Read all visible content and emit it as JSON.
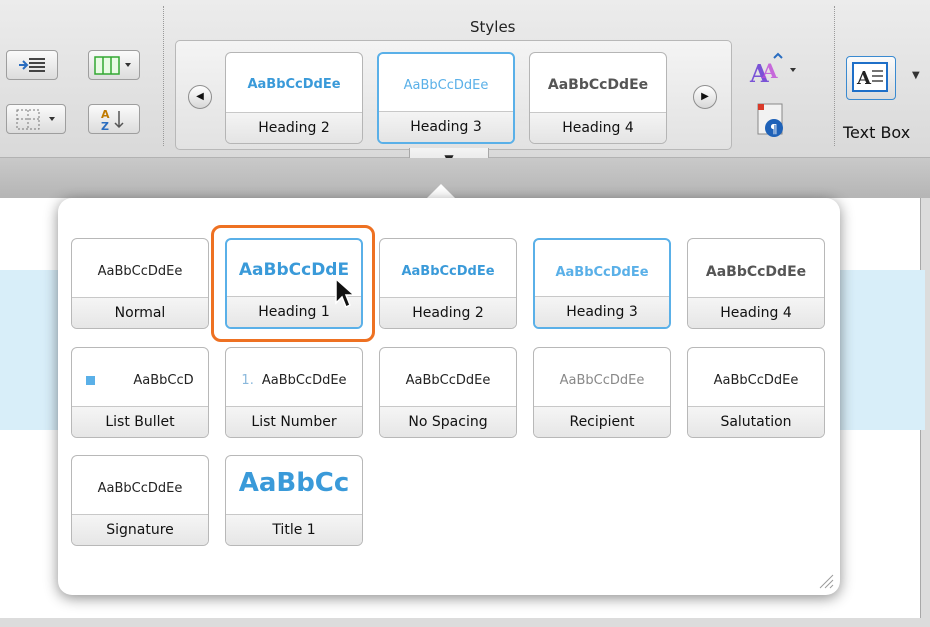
{
  "ribbon": {
    "group_title": "Styles",
    "text_box_label": "Text Box",
    "gallery": [
      {
        "label": "Heading 2",
        "sample": "AaBbCcDdEe",
        "color": "#3a9ad9",
        "bold": true,
        "selected": false
      },
      {
        "label": "Heading 3",
        "sample": "AaBbCcDdEe",
        "color": "#5ab0e8",
        "bold": false,
        "selected": true
      },
      {
        "label": "Heading 4",
        "sample": "AaBbCcDdEe",
        "color": "#555555",
        "bold": true,
        "selected": false
      }
    ]
  },
  "popup": {
    "styles": [
      {
        "label": "Normal",
        "sample": "AaBbCcDdEe",
        "color": "#222222"
      },
      {
        "label": "Heading 1",
        "sample": "AaBbCcDdE",
        "color": "#3a9ad9",
        "selected": true
      },
      {
        "label": "Heading 2",
        "sample": "AaBbCcDdEe",
        "color": "#3a9ad9"
      },
      {
        "label": "Heading 3",
        "sample": "AaBbCcDdEe",
        "color": "#5ab0e8",
        "selected": true
      },
      {
        "label": "Heading 4",
        "sample": "AaBbCcDdEe",
        "color": "#555555"
      },
      {
        "label": "List Bullet",
        "sample": "AaBbCcD",
        "color": "#222222"
      },
      {
        "label": "List Number",
        "sample": "AaBbCcDdEe",
        "prefix": "1.",
        "color": "#222222"
      },
      {
        "label": "No Spacing",
        "sample": "AaBbCcDdEe",
        "color": "#222222"
      },
      {
        "label": "Recipient",
        "sample": "AaBbCcDdEe",
        "color": "#888888"
      },
      {
        "label": "Salutation",
        "sample": "AaBbCcDdEe",
        "color": "#222222"
      },
      {
        "label": "Signature",
        "sample": "AaBbCcDdEe",
        "color": "#222222"
      },
      {
        "label": "Title 1",
        "sample": "AaBbCc",
        "color": "#3a9ad9"
      }
    ]
  },
  "colors": {
    "accent": "#5ab0e8",
    "highlight": "#ee7122"
  }
}
